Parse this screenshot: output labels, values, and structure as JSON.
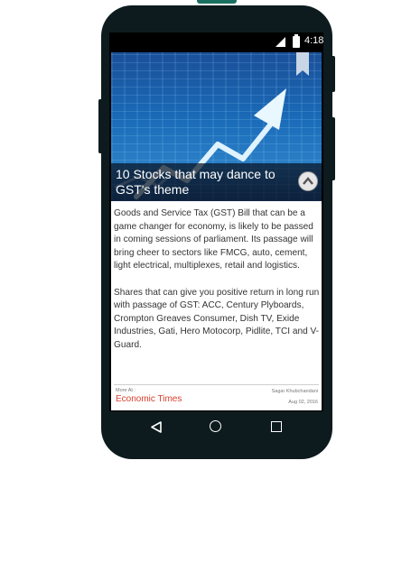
{
  "status_bar": {
    "time": "4:18",
    "icons": [
      "signal-icon",
      "battery-icon"
    ]
  },
  "article": {
    "title": "10 Stocks that may dance to GST's theme",
    "paragraphs": [
      "Goods and Service Tax (GST) Bill that can be a game changer for economy, is likely to be passed in coming sessions of parliament. Its passage will bring cheer to sectors like FMCG, auto, cement, light electrical, multiplexes, retail and logistics.",
      "Shares that can give you positive return in long run with passage of GST: ACC, Century Plyboards, Crompton Greaves Consumer, Dish TV, Exide Industries, Gati, Hero Motocorp, Pidlite, TCI and V-Guard."
    ],
    "more_at_label": "More At :",
    "source": "Economic Times",
    "author": "Sagar Khubchandani",
    "date": "Aug 02, 2016"
  },
  "nav": {
    "icons": [
      "back-icon",
      "home-icon",
      "recents-icon"
    ]
  },
  "colors": {
    "source_link": "#d8402f",
    "phone_body": "#0d1b1e"
  }
}
